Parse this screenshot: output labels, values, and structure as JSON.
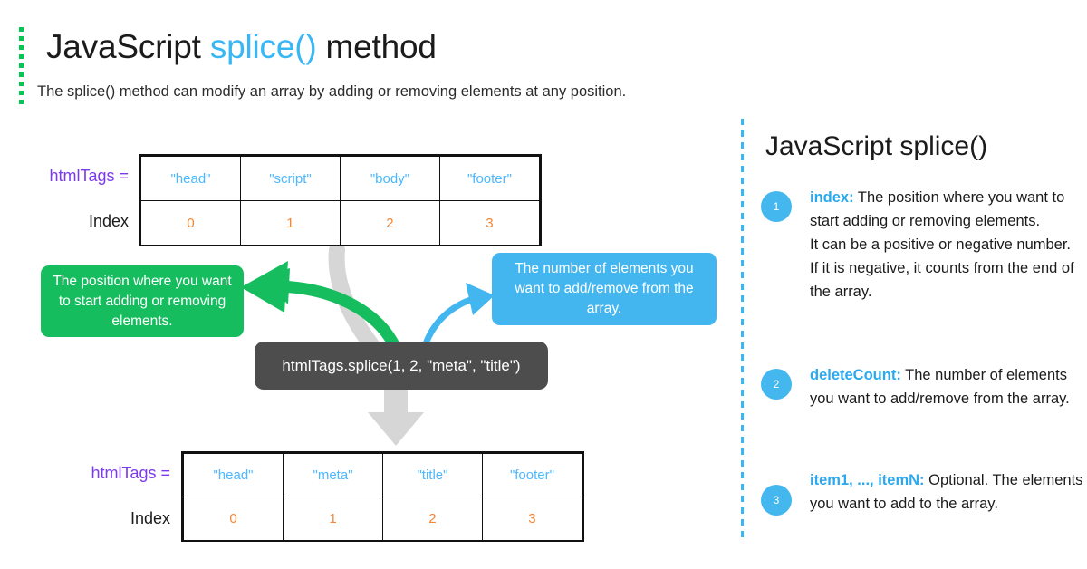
{
  "header": {
    "title_prefix": "JavaScript ",
    "title_accent": "splice()",
    "title_suffix": " method",
    "subtitle": "The splice() method can modify an array by adding or removing elements at any position.",
    "accent_color": "#39b7f5",
    "rule_color": "#00c853"
  },
  "top_table": {
    "var_label": "htmlTags =",
    "index_label": "Index",
    "values": [
      "\"head\"",
      "\"script\"",
      "\"body\"",
      "\"footer\""
    ],
    "indexes": [
      "0",
      "1",
      "2",
      "3"
    ],
    "value_color": "#4db8ff",
    "index_color": "#f58634",
    "label_color": "#7c3aed"
  },
  "bottom_table": {
    "var_label": "htmlTags =",
    "index_label": "Index",
    "values": [
      "\"head\"",
      "\"meta\"",
      "\"title\"",
      "\"footer\""
    ],
    "indexes": [
      "0",
      "1",
      "2",
      "3"
    ],
    "value_color": "#4db8ff",
    "index_color": "#f58634",
    "label_color": "#7c3aed"
  },
  "code": {
    "text": "htmlTags.splice(1, 2, \"meta\", \"title\")",
    "background": "#4d4d4d"
  },
  "callouts": {
    "index_note": "The position where you want to start adding or removing elements.",
    "index_note_color": "#16bd5f",
    "delete_note": "The number of elements you want to add/remove from the array.",
    "delete_note_color": "#43b6f0"
  },
  "panel": {
    "title": "JavaScript splice()",
    "divider_color": "#39b7f5",
    "badge_color": "#44b7ef",
    "params": [
      {
        "number": "1",
        "keyword": "index:",
        "description": " The position where you want to start adding or removing elements.",
        "extra1": "It can be a positive or negative number.",
        "extra2": "If it is negative, it counts from the end of the array."
      },
      {
        "number": "2",
        "keyword": "deleteCount:",
        "description": " The number of elements you want to add/remove from the array.",
        "extra1": "",
        "extra2": ""
      },
      {
        "number": "3",
        "keyword": "item1, ..., itemN:",
        "description": "  Optional. The elements you want to add to the array.",
        "extra1": "",
        "extra2": ""
      }
    ]
  }
}
